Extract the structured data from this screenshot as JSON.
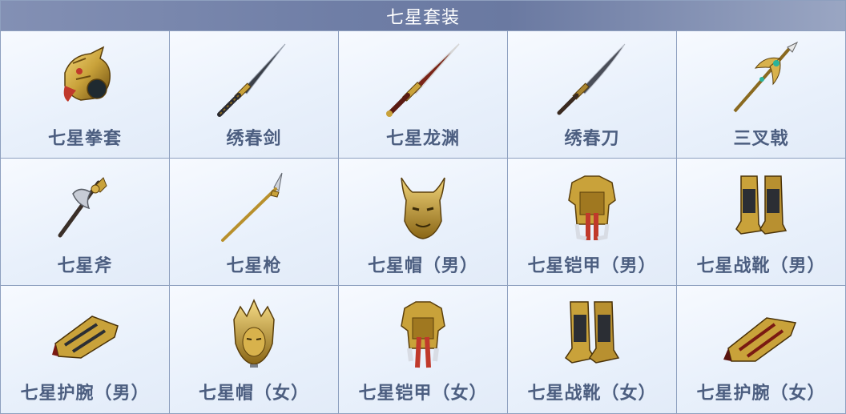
{
  "title": "七星套装",
  "items": [
    {
      "name": "七星拳套",
      "icon": "gold-dragon-gauntlet-icon"
    },
    {
      "name": "绣春剑",
      "icon": "dark-sword-icon"
    },
    {
      "name": "七星龙渊",
      "icon": "red-long-sword-icon"
    },
    {
      "name": "绣春刀",
      "icon": "curved-blade-icon"
    },
    {
      "name": "三叉戟",
      "icon": "trident-halberd-icon"
    },
    {
      "name": "七星斧",
      "icon": "battle-axe-icon"
    },
    {
      "name": "七星枪",
      "icon": "spear-icon"
    },
    {
      "name": "七星帽（男）",
      "icon": "horned-helmet-icon"
    },
    {
      "name": "七星铠甲（男）",
      "icon": "armor-icon"
    },
    {
      "name": "七星战靴（男）",
      "icon": "boots-icon"
    },
    {
      "name": "七星护腕（男）",
      "icon": "bracer-icon"
    },
    {
      "name": "七星帽（女）",
      "icon": "crown-helmet-icon"
    },
    {
      "name": "七星铠甲（女）",
      "icon": "armor-icon"
    },
    {
      "name": "七星战靴（女）",
      "icon": "boots-icon"
    },
    {
      "name": "七星护腕（女）",
      "icon": "bracer-icon"
    }
  ],
  "colors": {
    "header_bg": "#6f7ea6",
    "label_text": "#4c5e80",
    "border": "#8ea0bf",
    "gold": "#c9a23a",
    "dark_gold": "#7a5a14",
    "red": "#c0392b"
  }
}
